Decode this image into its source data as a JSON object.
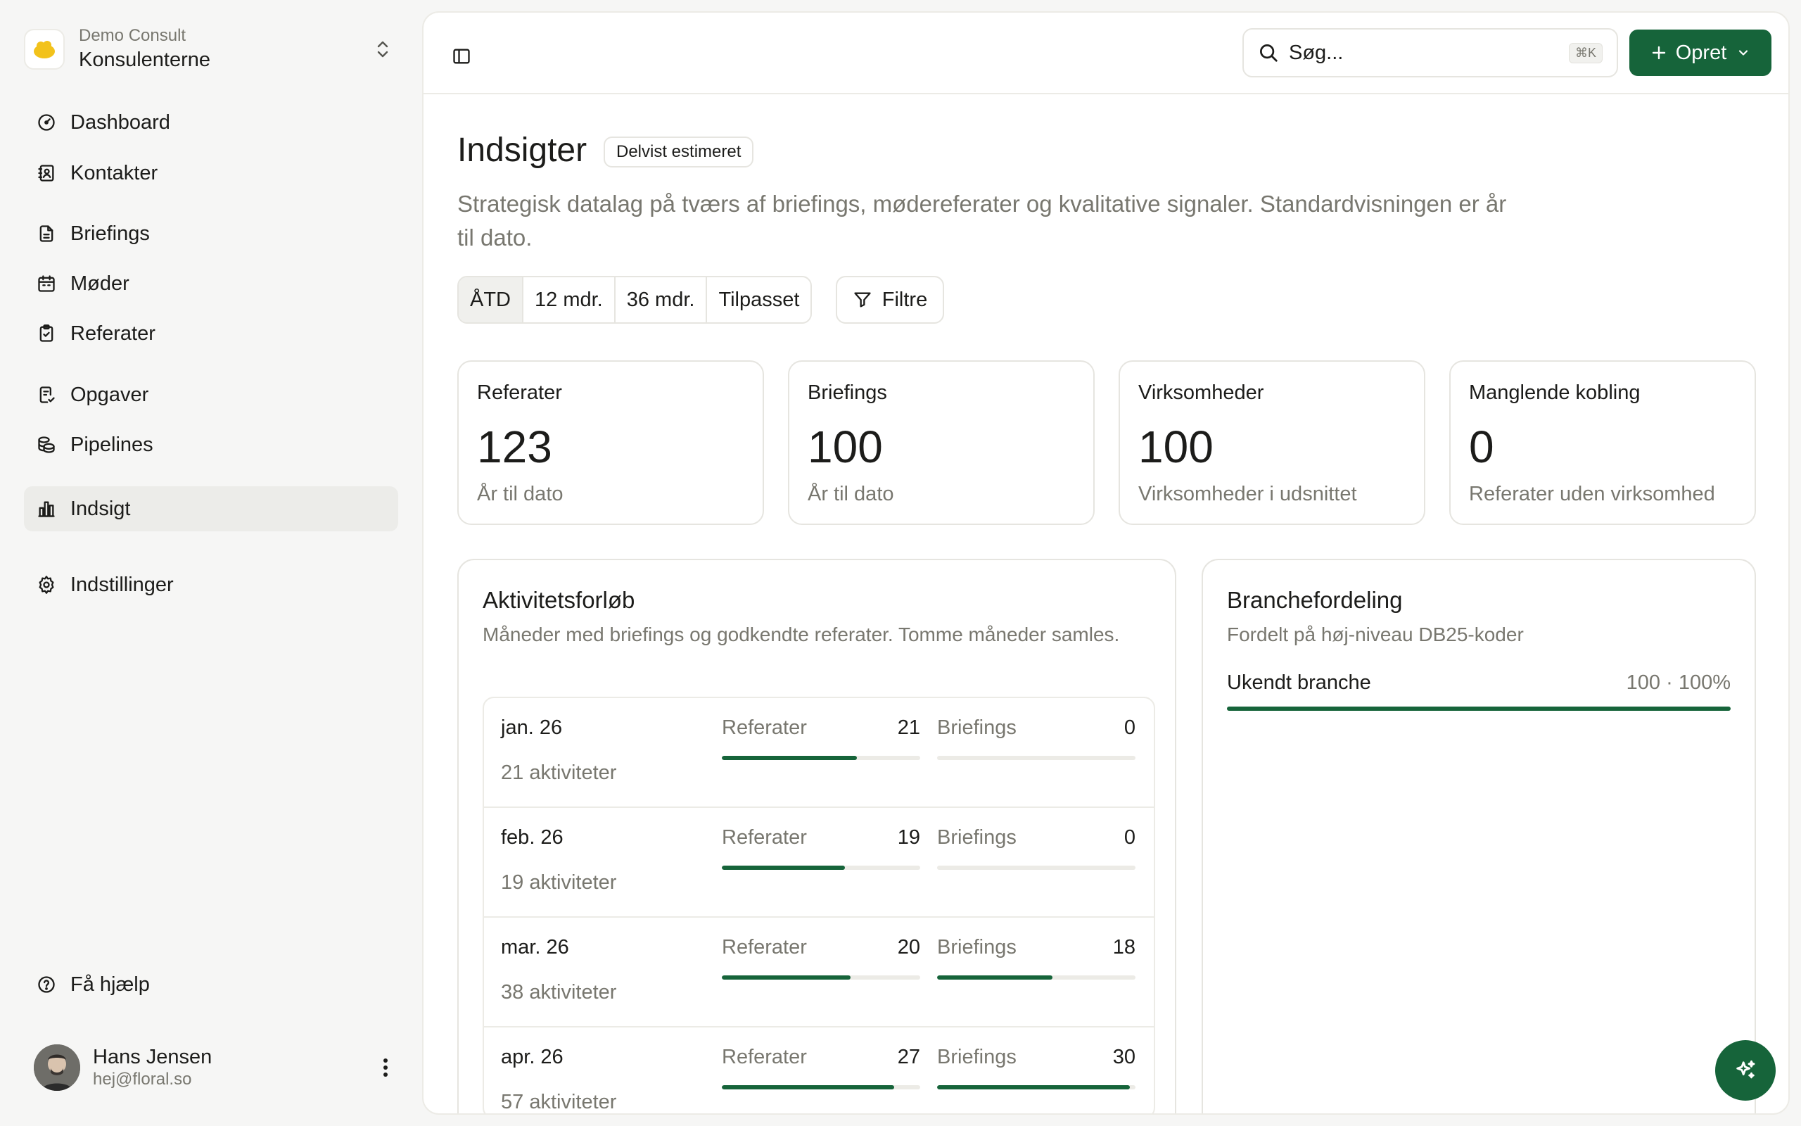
{
  "workspace": {
    "org": "Demo Consult",
    "name": "Konsulenterne"
  },
  "nav": [
    {
      "label": "Dashboard",
      "icon": "dashboard-icon"
    },
    {
      "label": "Kontakter",
      "icon": "contacts-icon"
    },
    {
      "label": "Briefings",
      "icon": "document-icon"
    },
    {
      "label": "Møder",
      "icon": "calendar-icon"
    },
    {
      "label": "Referater",
      "icon": "clipboard-icon"
    },
    {
      "label": "Opgaver",
      "icon": "task-icon"
    },
    {
      "label": "Pipelines",
      "icon": "coins-icon"
    },
    {
      "label": "Indsigt",
      "icon": "bar-chart-icon",
      "active": true
    },
    {
      "label": "Indstillinger",
      "icon": "gear-icon"
    },
    {
      "label": "Få hjælp",
      "icon": "help-icon"
    }
  ],
  "user": {
    "name": "Hans Jensen",
    "email": "hej@floral.so"
  },
  "topbar": {
    "search_placeholder": "Søg...",
    "shortcut": "⌘K",
    "create_label": "Opret"
  },
  "page": {
    "title": "Indsigter",
    "badge": "Delvist estimeret",
    "subtitle": "Strategisk datalag på tværs af briefings, mødereferater og kvalitative signaler. Standardvisningen er år til dato.",
    "ranges": [
      "ÅTD",
      "12 mdr.",
      "36 mdr.",
      "Tilpasset"
    ],
    "selected_range": "ÅTD",
    "filter_label": "Filtre"
  },
  "kpis": [
    {
      "label": "Referater",
      "value": "123",
      "caption": "År til dato"
    },
    {
      "label": "Briefings",
      "value": "100",
      "caption": "År til dato"
    },
    {
      "label": "Virksomheder",
      "value": "100",
      "caption": "Virksomheder i udsnittet"
    },
    {
      "label": "Manglende kobling",
      "value": "0",
      "caption": "Referater uden virksomhed"
    }
  ],
  "activity": {
    "title": "Aktivitetsforløb",
    "description": "Måneder med briefings og godkendte referater. Tomme måneder samles.",
    "ref_label": "Referater",
    "brief_label": "Briefings",
    "rows": [
      {
        "month": "jan. 26",
        "count": "21 aktiviteter",
        "referater": "21",
        "briefings": "0",
        "ref_fill": 0.68,
        "brief_fill": 0
      },
      {
        "month": "feb. 26",
        "count": "19 aktiviteter",
        "referater": "19",
        "briefings": "0",
        "ref_fill": 0.62,
        "brief_fill": 0
      },
      {
        "month": "mar. 26",
        "count": "38 aktiviteter",
        "referater": "20",
        "briefings": "18",
        "ref_fill": 0.65,
        "brief_fill": 0.58
      },
      {
        "month": "apr. 26",
        "count": "57 aktiviteter",
        "referater": "27",
        "briefings": "30",
        "ref_fill": 0.87,
        "brief_fill": 0.97
      }
    ]
  },
  "industry": {
    "title": "Branchefordeling",
    "description": "Fordelt på høj-niveau DB25-koder",
    "rows": [
      {
        "name": "Ukendt branche",
        "value": "100 · 100%",
        "fill": 1.0
      }
    ]
  },
  "colors": {
    "accent": "#16643a",
    "muted": "#78776f",
    "border": "#e6e5e0"
  }
}
